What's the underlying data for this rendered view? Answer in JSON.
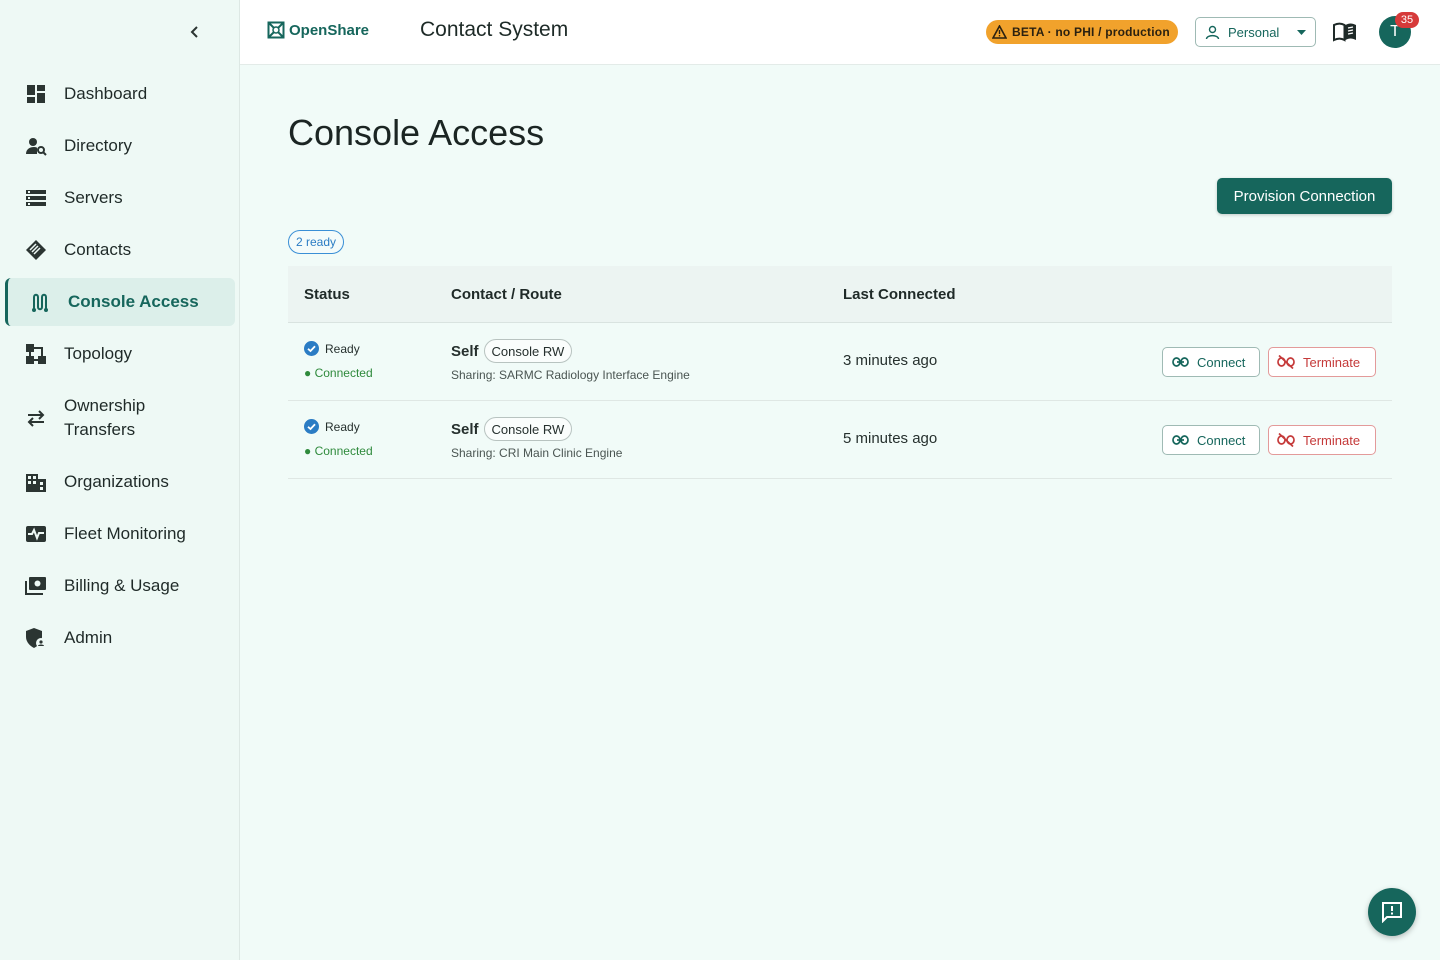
{
  "app": {
    "brand": "OpenShare",
    "system_title": "Contact System",
    "beta_label": "BETA · no PHI / production",
    "workspace": "Personal",
    "avatar_initial": "T",
    "notification_count": "35"
  },
  "sidebar": {
    "items": [
      {
        "label": "Dashboard",
        "icon": "dashboard-icon"
      },
      {
        "label": "Directory",
        "icon": "person-search-icon"
      },
      {
        "label": "Servers",
        "icon": "server-list-icon"
      },
      {
        "label": "Contacts",
        "icon": "contacts-icon"
      },
      {
        "label": "Console Access",
        "icon": "console-route-icon",
        "active": true
      },
      {
        "label": "Topology",
        "icon": "topology-icon"
      },
      {
        "label": "Ownership Transfers",
        "icon": "transfer-arrows-icon"
      },
      {
        "label": "Organizations",
        "icon": "building-icon"
      },
      {
        "label": "Fleet Monitoring",
        "icon": "monitor-pulse-icon"
      },
      {
        "label": "Billing & Usage",
        "icon": "billing-icon"
      },
      {
        "label": "Admin",
        "icon": "admin-shield-icon"
      }
    ]
  },
  "main": {
    "title": "Console Access",
    "provision_label": "Provision Connection",
    "ready_count": "2 ready",
    "columns": {
      "status": "Status",
      "contact": "Contact / Route",
      "last": "Last Connected"
    },
    "rows": [
      {
        "status": "Ready",
        "connection": "● Connected",
        "contact": "Self",
        "tag": "Console RW",
        "sharing": "Sharing: SARMC Radiology Interface Engine",
        "last_connected": "3 minutes ago",
        "connect_label": "Connect",
        "terminate_label": "Terminate"
      },
      {
        "status": "Ready",
        "connection": "● Connected",
        "contact": "Self",
        "tag": "Console RW",
        "sharing": "Sharing: CRI Main Clinic Engine",
        "last_connected": "5 minutes ago",
        "connect_label": "Connect",
        "terminate_label": "Terminate"
      }
    ]
  },
  "colors": {
    "primary": "#16665c",
    "beta": "#f1a22c",
    "danger": "#c53a3a",
    "ready_blue": "#2b7cc4",
    "connected_green": "#2f8a3c"
  }
}
